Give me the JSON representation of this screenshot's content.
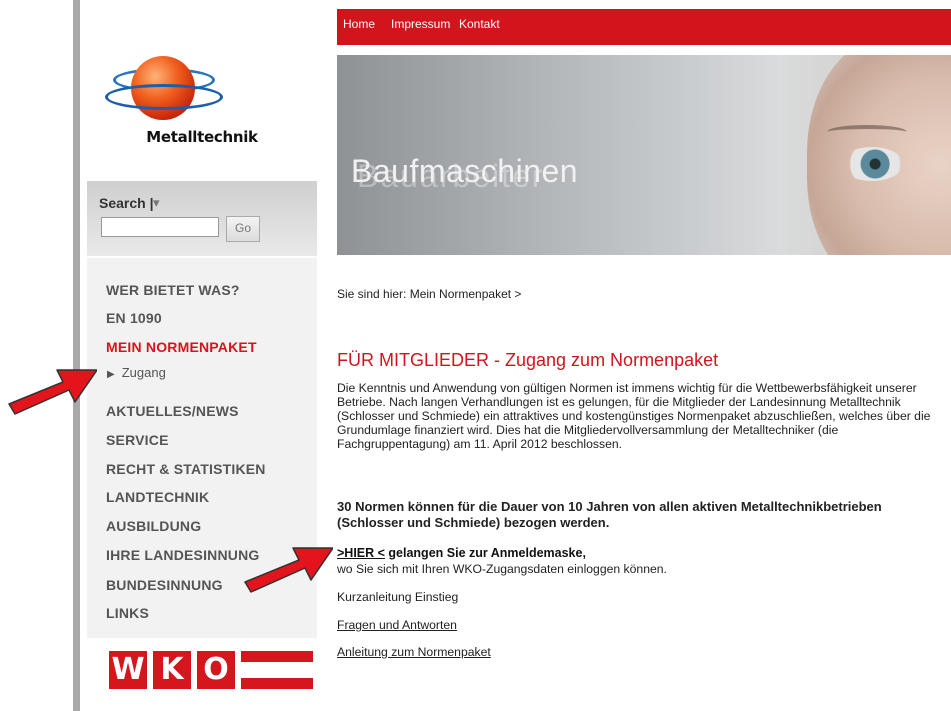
{
  "logo": {
    "text": "Metalltechnik"
  },
  "search": {
    "label": "Search |",
    "caret": "▾",
    "value": "",
    "placeholder": "",
    "go_label": "Go"
  },
  "nav": {
    "items": [
      {
        "label": "WER BIETET WAS?",
        "active": false
      },
      {
        "label": "EN 1090",
        "active": false
      },
      {
        "label": "MEIN NORMENPAKET",
        "active": true
      },
      {
        "label": "AKTUELLES/NEWS",
        "active": false
      },
      {
        "label": "SERVICE",
        "active": false
      },
      {
        "label": "RECHT & STATISTIKEN",
        "active": false
      },
      {
        "label": "LANDTECHNIK",
        "active": false
      },
      {
        "label": "AUSBILDUNG",
        "active": false
      },
      {
        "label": "IHRE LANDESINNUNG",
        "active": false
      },
      {
        "label": "BUNDESINNUNG",
        "active": false
      },
      {
        "label": "LINKS",
        "active": false
      }
    ],
    "sub_item": {
      "label": "Zugang"
    }
  },
  "wko": {
    "letters": [
      "W",
      "K",
      "O"
    ]
  },
  "topnav": {
    "home": "Home",
    "impressum": "Impressum",
    "kontakt": "Kontakt"
  },
  "banner": {
    "text": "Baufmaschinen",
    "ghost": "Bauarbeiter"
  },
  "breadcrumb": "Sie sind hier: Mein Normenpaket >",
  "main": {
    "title": "FÜR MITGLIEDER - Zugang zum Normenpaket",
    "paragraph1": "Die Kenntnis und Anwendung von gültigen Normen ist immens wichtig für die Wettbewerbsfähigkeit unserer Betriebe. Nach langen Verhandlungen ist es gelungen, für die Mitglieder der Landesinnung Metalltechnik (Schlosser und Schmiede) ein attraktives und kostengünstiges Normenpaket abzuschließen, welches über die Grundumlage finanziert wird. Dies hat die Mitgliedervollversammlung der Metalltechniker (die Fachgruppentagung) am 11. April 2012 beschlossen.",
    "paragraph2": "30 Normen können für die Dauer von 10 Jahren von allen aktiven Metalltechnikbetrieben (Schlosser und Schmiede) bezogen werden.",
    "hier_link": ">HIER <",
    "hier_text": " gelangen Sie zur Anmeldemaske,",
    "hier_sub": "wo Sie sich mit Ihren WKO-Zugangsdaten einloggen können.",
    "link1": "Kurzanleitung Einstieg",
    "link2": "Fragen und Antworten",
    "link3": "Anleitung zum Normenpaket"
  },
  "colors": {
    "brand_red": "#d2141d",
    "sidebar_bg": "#f2f2f2",
    "arrow_red": "#e3141c"
  }
}
